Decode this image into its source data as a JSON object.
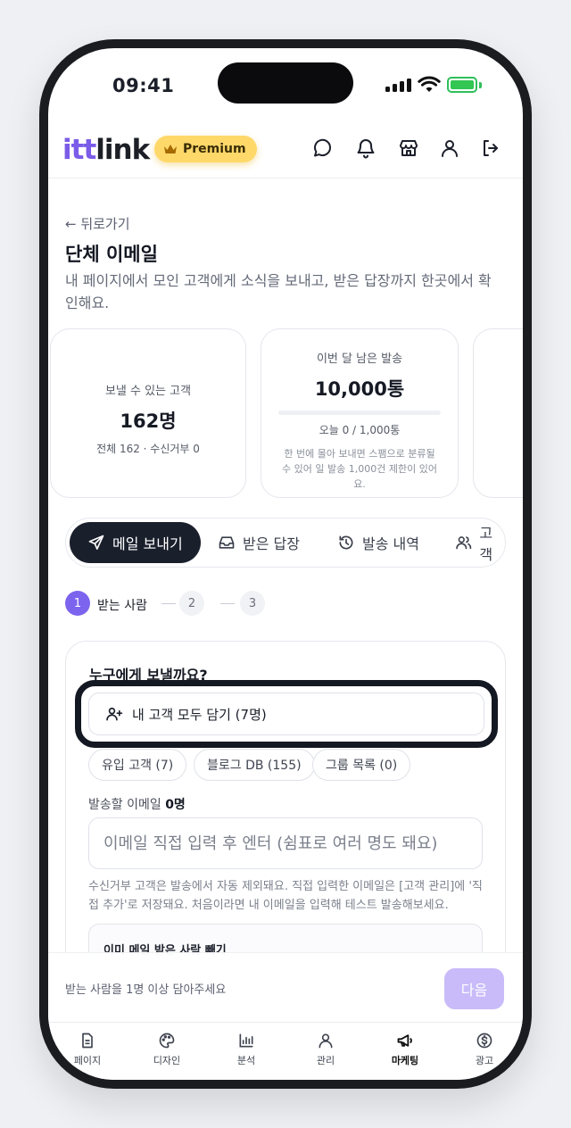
{
  "status": {
    "time": "09:41"
  },
  "header": {
    "logo_part1": "itt",
    "logo_part2": "link",
    "premium_label": "Premium"
  },
  "page": {
    "back_label": "← 뒤로가기",
    "title": "단체 이메일",
    "description": "내 페이지에서 모인 고객에게 소식을 보내고, 받은 답장까지 한곳에서 확인해요."
  },
  "stats": {
    "sendable": {
      "label": "보낼 수 있는 고객",
      "value": "162명",
      "detail": "전체 162 · 수신거부 0"
    },
    "monthly": {
      "label": "이번 달 남은 발송",
      "value": "10,000통",
      "today": "오늘 0 / 1,000통",
      "today_progress": 0,
      "note": "한 번에 몰아 보내면 스팸으로 분류될 수 있어 일 발송 1,000건 제한이 있어요."
    }
  },
  "tabs": [
    {
      "label": "메일 보내기",
      "icon": "send-icon",
      "active": true
    },
    {
      "label": "받은 답장",
      "icon": "inbox-icon",
      "active": false
    },
    {
      "label": "발송 내역",
      "icon": "history-icon",
      "active": false
    },
    {
      "label": "고객",
      "icon": "users-icon",
      "active": false
    }
  ],
  "steps": {
    "current": "1",
    "current_label": "받는 사람",
    "step2": "2",
    "step3": "3"
  },
  "recipients": {
    "question": "누구에게 보낼까요?",
    "add_all_label": "내 고객 모두 담기 (7명)",
    "chips": [
      "유입 고객 (7)",
      "블로그 DB (155)",
      "그룹 목록 (0)"
    ],
    "count_label": "발송할 이메일",
    "count_value": "0명",
    "input_placeholder": "이메일 직접 입력 후 엔터 (쉼표로 여러 명도 돼요)",
    "help_text": "수신거부 고객은 발송에서 자동 제외돼요. 직접 입력한 이메일은 [고객 관리]에 '직접 추가'로 저장돼요. 처음이라면 내 이메일을 입력해 테스트 발송해보세요.",
    "exclude_title": "이미 메일 받은 사람 빼기"
  },
  "bottom": {
    "hint": "받는 사람을 1명 이상 담아주세요",
    "next_label": "다음"
  },
  "nav": [
    {
      "label": "페이지",
      "icon": "page-icon"
    },
    {
      "label": "디자인",
      "icon": "palette-icon"
    },
    {
      "label": "분석",
      "icon": "chart-icon"
    },
    {
      "label": "관리",
      "icon": "user-icon"
    },
    {
      "label": "마케팅",
      "icon": "megaphone-icon",
      "active": true
    },
    {
      "label": "광고",
      "icon": "dollar-icon"
    }
  ],
  "colors": {
    "brand": "#7a5ce8",
    "premium": "#ffd86a",
    "dark": "#1a1f2c",
    "next_disabled": "#c9bbf9"
  }
}
